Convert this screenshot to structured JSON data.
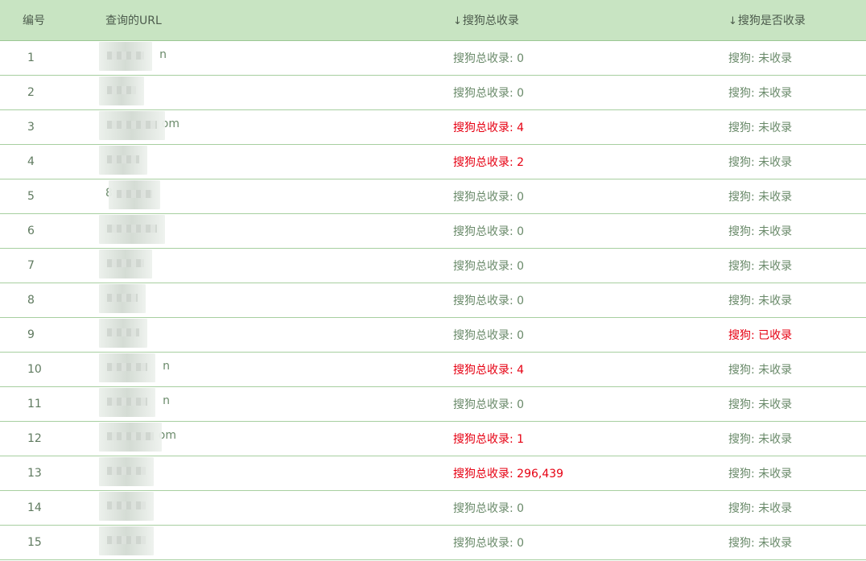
{
  "headers": {
    "id": "编号",
    "url": "查询的URL",
    "total": "搜狗总收录",
    "status": "搜狗是否收录",
    "sort_arrow": "↓"
  },
  "colors": {
    "accent": "#c8e4c2",
    "highlight": "#e60012",
    "normal": "#6a8a6a"
  },
  "rows": [
    {
      "id": "1",
      "url_suffix": "n",
      "total": "搜狗总收录: 0",
      "total_red": false,
      "status": "搜狗: 未收录",
      "status_red": false
    },
    {
      "id": "2",
      "url_suffix": "",
      "total": "搜狗总收录: 0",
      "total_red": false,
      "status": "搜狗: 未收录",
      "status_red": false
    },
    {
      "id": "3",
      "url_suffix": "om",
      "total": "搜狗总收录: 4",
      "total_red": true,
      "status": "搜狗: 未收录",
      "status_red": false
    },
    {
      "id": "4",
      "url_suffix": "",
      "total": "搜狗总收录: 2",
      "total_red": true,
      "status": "搜狗: 未收录",
      "status_red": false
    },
    {
      "id": "5",
      "url_suffix": "8",
      "total": "搜狗总收录: 0",
      "total_red": false,
      "status": "搜狗: 未收录",
      "status_red": false
    },
    {
      "id": "6",
      "url_suffix": "",
      "total": "搜狗总收录: 0",
      "total_red": false,
      "status": "搜狗: 未收录",
      "status_red": false
    },
    {
      "id": "7",
      "url_suffix": "",
      "total": "搜狗总收录: 0",
      "total_red": false,
      "status": "搜狗: 未收录",
      "status_red": false
    },
    {
      "id": "8",
      "url_suffix": "",
      "total": "搜狗总收录: 0",
      "total_red": false,
      "status": "搜狗: 未收录",
      "status_red": false
    },
    {
      "id": "9",
      "url_suffix": "",
      "total": "搜狗总收录: 0",
      "total_red": false,
      "status": "搜狗: 已收录",
      "status_red": true
    },
    {
      "id": "10",
      "url_suffix": "n",
      "total": "搜狗总收录: 4",
      "total_red": true,
      "status": "搜狗: 未收录",
      "status_red": false
    },
    {
      "id": "11",
      "url_suffix": "n",
      "total": "搜狗总收录: 0",
      "total_red": false,
      "status": "搜狗: 未收录",
      "status_red": false
    },
    {
      "id": "12",
      "url_suffix": "om",
      "total": "搜狗总收录: 1",
      "total_red": true,
      "status": "搜狗: 未收录",
      "status_red": false
    },
    {
      "id": "13",
      "url_suffix": "",
      "total": "搜狗总收录: 296,439",
      "total_red": true,
      "status": "搜狗: 未收录",
      "status_red": false
    },
    {
      "id": "14",
      "url_suffix": "",
      "total": "搜狗总收录: 0",
      "total_red": false,
      "status": "搜狗: 未收录",
      "status_red": false
    },
    {
      "id": "15",
      "url_suffix": "",
      "total": "搜狗总收录: 0",
      "total_red": false,
      "status": "搜狗: 未收录",
      "status_red": false
    }
  ]
}
